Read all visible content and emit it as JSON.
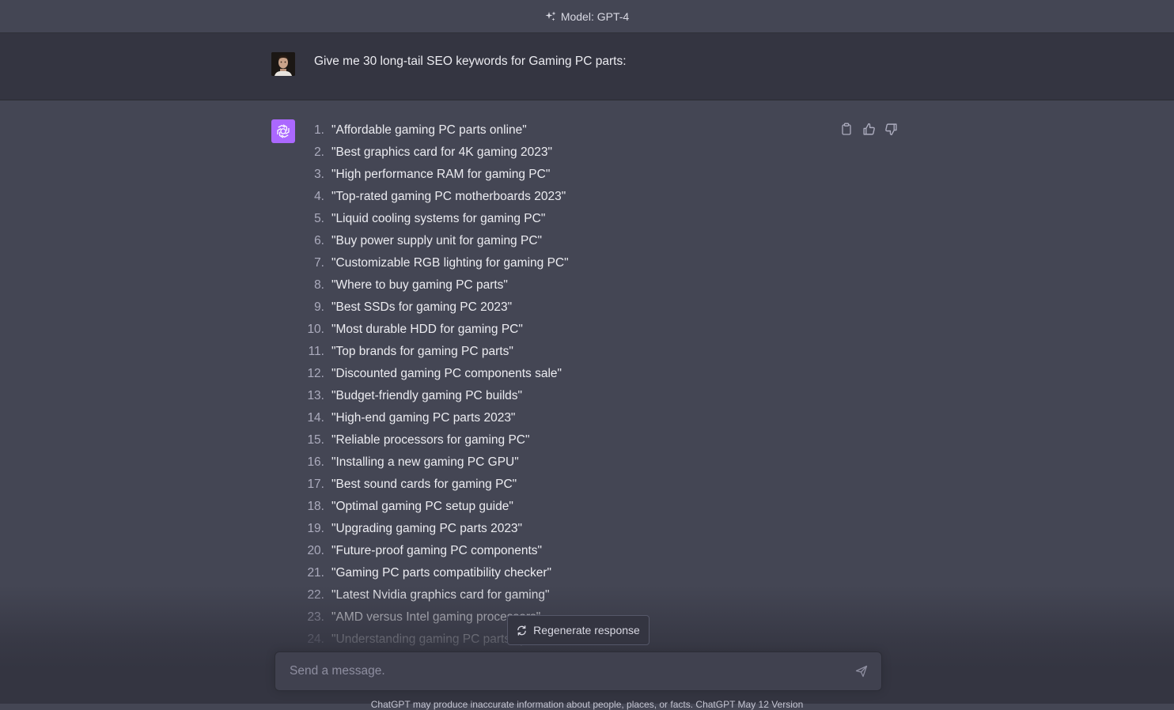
{
  "header": {
    "model_label": "Model: GPT-4",
    "icon": "sparkle-icon"
  },
  "user_message": {
    "text": "Give me 30 long-tail SEO keywords for Gaming PC parts:"
  },
  "assistant_message": {
    "actions": [
      "copy-icon",
      "thumbs-up-icon",
      "thumbs-down-icon"
    ],
    "items": [
      {
        "num": "1.",
        "text": "\"Affordable gaming PC parts online\""
      },
      {
        "num": "2.",
        "text": "\"Best graphics card for 4K gaming 2023\""
      },
      {
        "num": "3.",
        "text": "\"High performance RAM for gaming PC\""
      },
      {
        "num": "4.",
        "text": "\"Top-rated gaming PC motherboards 2023\""
      },
      {
        "num": "5.",
        "text": "\"Liquid cooling systems for gaming PC\""
      },
      {
        "num": "6.",
        "text": "\"Buy power supply unit for gaming PC\""
      },
      {
        "num": "7.",
        "text": "\"Customizable RGB lighting for gaming PC\""
      },
      {
        "num": "8.",
        "text": "\"Where to buy gaming PC parts\""
      },
      {
        "num": "9.",
        "text": "\"Best SSDs for gaming PC 2023\""
      },
      {
        "num": "10.",
        "text": "\"Most durable HDD for gaming PC\""
      },
      {
        "num": "11.",
        "text": "\"Top brands for gaming PC parts\""
      },
      {
        "num": "12.",
        "text": "\"Discounted gaming PC components sale\""
      },
      {
        "num": "13.",
        "text": "\"Budget-friendly gaming PC builds\""
      },
      {
        "num": "14.",
        "text": "\"High-end gaming PC parts 2023\""
      },
      {
        "num": "15.",
        "text": "\"Reliable processors for gaming PC\""
      },
      {
        "num": "16.",
        "text": "\"Installing a new gaming PC GPU\""
      },
      {
        "num": "17.",
        "text": "\"Best sound cards for gaming PC\""
      },
      {
        "num": "18.",
        "text": "\"Optimal gaming PC setup guide\""
      },
      {
        "num": "19.",
        "text": "\"Upgrading gaming PC parts 2023\""
      },
      {
        "num": "20.",
        "text": "\"Future-proof gaming PC components\""
      },
      {
        "num": "21.",
        "text": "\"Gaming PC parts compatibility checker\""
      },
      {
        "num": "22.",
        "text": "\"Latest Nvidia graphics card for gaming\""
      },
      {
        "num": "23.",
        "text": "\"AMD versus Intel gaming processors\""
      },
      {
        "num": "24.",
        "text": "\"Understanding gaming PC parts specs\""
      }
    ]
  },
  "regenerate": {
    "label": "Regenerate response",
    "icon": "refresh-icon"
  },
  "composer": {
    "placeholder": "Send a message.",
    "value": "",
    "send_icon": "send-icon"
  },
  "footer": {
    "note": "ChatGPT may produce inaccurate information about people, places, or facts. ChatGPT May 12 Version"
  },
  "colors": {
    "page_bg": "#444654",
    "user_row_bg": "#343541",
    "assistant_avatar": "#ab68ff",
    "composer_bg": "#40414f",
    "text": "#ececf1"
  }
}
